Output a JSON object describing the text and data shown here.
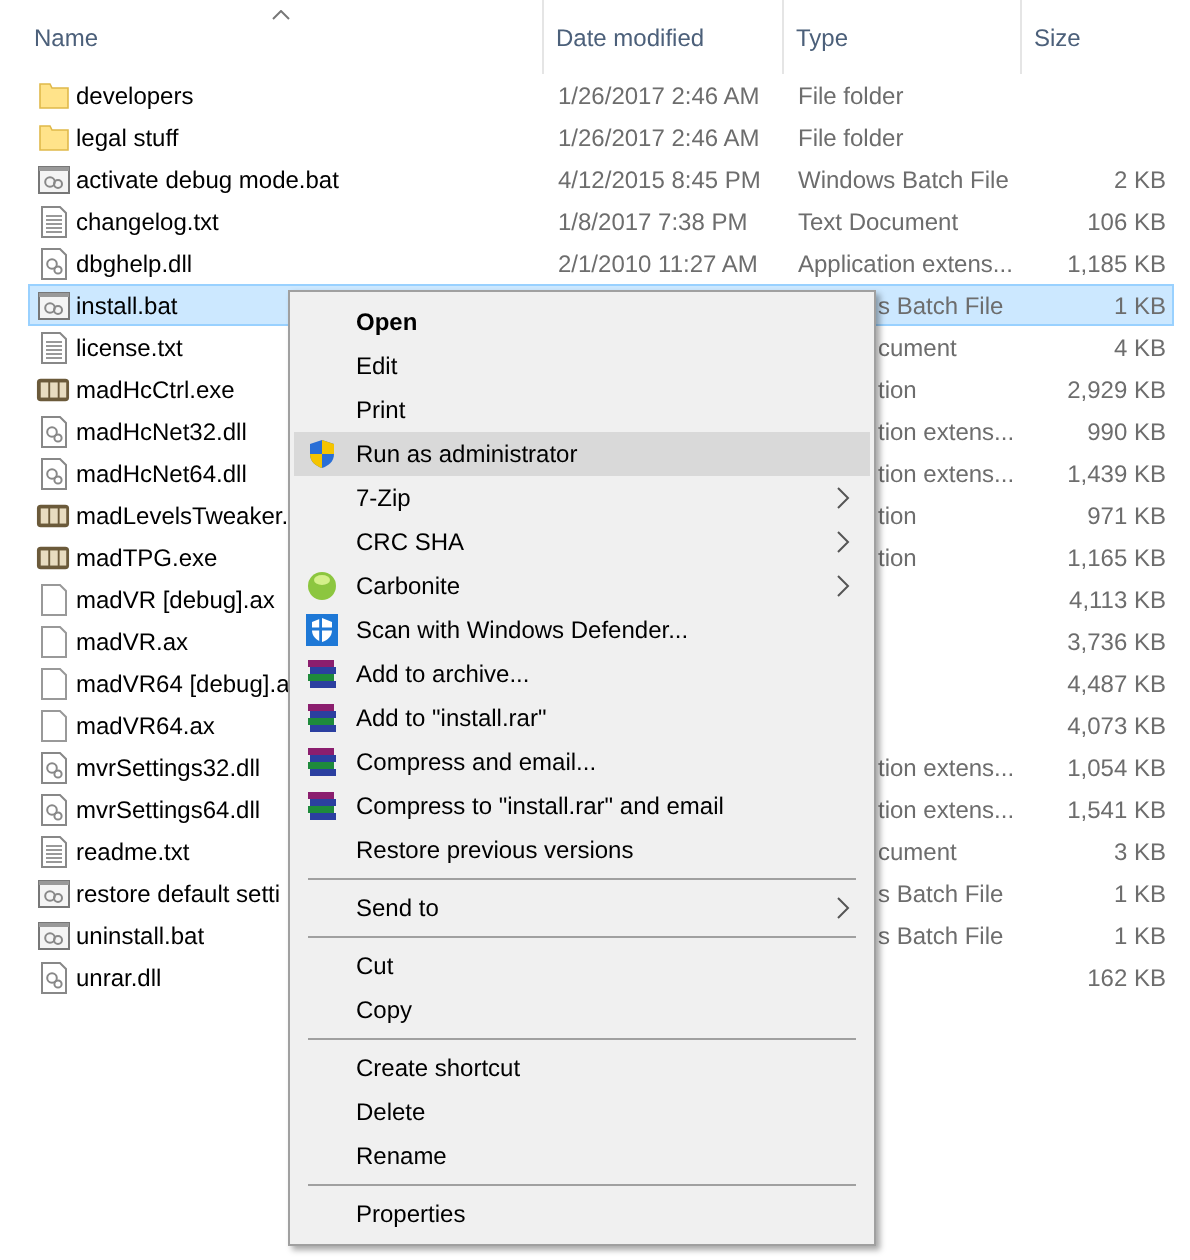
{
  "columns": [
    {
      "label": "Name",
      "sorted": true
    },
    {
      "label": "Date modified",
      "sorted": false
    },
    {
      "label": "Type",
      "sorted": false
    },
    {
      "label": "Size",
      "sorted": false
    }
  ],
  "files": [
    {
      "kind": "folder",
      "name": "developers",
      "date": "1/26/2017 2:46 AM",
      "type": "File folder",
      "selected": false
    },
    {
      "kind": "folder",
      "name": "legal stuff",
      "date": "1/26/2017 2:46 AM",
      "type": "File folder",
      "selected": false
    },
    {
      "kind": "batch",
      "name": "activate debug mode.bat",
      "date": "4/12/2015 8:45 PM",
      "type": "Windows Batch File",
      "size": "2 KB",
      "selected": false
    },
    {
      "kind": "text",
      "name": "changelog.txt",
      "date": "1/8/2017 7:38 PM",
      "type": "Text Document",
      "size": "106 KB",
      "selected": false
    },
    {
      "kind": "dll",
      "name": "dbghelp.dll",
      "date": "2/1/2010 11:27 AM",
      "type": "Application extens...",
      "size": "1,185 KB",
      "selected": false
    },
    {
      "kind": "batch",
      "name": "install.bat",
      "type": "s Batch File",
      "size": "1 KB",
      "selected": true
    },
    {
      "kind": "text",
      "name": "license.txt",
      "type": "cument",
      "size": "4 KB",
      "selected": false
    },
    {
      "kind": "exe",
      "name": "madHcCtrl.exe",
      "type": "tion",
      "size": "2,929 KB",
      "selected": false
    },
    {
      "kind": "dll",
      "name": "madHcNet32.dll",
      "type": "tion extens...",
      "size": "990 KB",
      "selected": false
    },
    {
      "kind": "dll",
      "name": "madHcNet64.dll",
      "type": "tion extens...",
      "size": "1,439 KB",
      "selected": false
    },
    {
      "kind": "exe",
      "name": "madLevelsTweaker.",
      "type": "tion",
      "size": "971 KB",
      "selected": false
    },
    {
      "kind": "exe",
      "name": "madTPG.exe",
      "type": "tion",
      "size": "1,165 KB",
      "selected": false
    },
    {
      "kind": "blank",
      "name": "madVR [debug].ax",
      "size": "4,113 KB",
      "selected": false
    },
    {
      "kind": "blank",
      "name": "madVR.ax",
      "size": "3,736 KB",
      "selected": false
    },
    {
      "kind": "blank",
      "name": "madVR64 [debug].a",
      "size": "4,487 KB",
      "selected": false
    },
    {
      "kind": "blank",
      "name": "madVR64.ax",
      "size": "4,073 KB",
      "selected": false
    },
    {
      "kind": "dll",
      "name": "mvrSettings32.dll",
      "type": "tion extens...",
      "size": "1,054 KB",
      "selected": false
    },
    {
      "kind": "dll",
      "name": "mvrSettings64.dll",
      "type": "tion extens...",
      "size": "1,541 KB",
      "selected": false
    },
    {
      "kind": "text",
      "name": "readme.txt",
      "type": "cument",
      "size": "3 KB",
      "selected": false
    },
    {
      "kind": "batch",
      "name": "restore default setti",
      "type": "s Batch File",
      "size": "1 KB",
      "selected": false
    },
    {
      "kind": "batch",
      "name": "uninstall.bat",
      "type": "s Batch File",
      "size": "1 KB",
      "selected": false
    },
    {
      "kind": "dll",
      "name": "unrar.dll",
      "size": "162 KB",
      "selected": false
    }
  ],
  "context_menu": {
    "groups": [
      [
        {
          "label": "Open",
          "default": true,
          "selected": false,
          "submenu": false
        },
        {
          "label": "Edit",
          "default": false,
          "selected": false,
          "submenu": false
        },
        {
          "label": "Print",
          "default": false,
          "selected": false,
          "submenu": false
        },
        {
          "label": "Run as administrator",
          "kind": "shield",
          "default": false,
          "selected": true,
          "submenu": false
        },
        {
          "label": "7-Zip",
          "default": false,
          "selected": false,
          "submenu": true
        },
        {
          "label": "CRC SHA",
          "default": false,
          "selected": false,
          "submenu": true
        },
        {
          "label": "Carbonite",
          "kind": "ball",
          "default": false,
          "selected": false,
          "submenu": true
        },
        {
          "label": "Scan with Windows Defender...",
          "kind": "defender",
          "default": false,
          "selected": false,
          "submenu": false
        },
        {
          "label": "Add to archive...",
          "kind": "books",
          "default": false,
          "selected": false,
          "submenu": false
        },
        {
          "label": "Add to \"install.rar\"",
          "kind": "books",
          "default": false,
          "selected": false,
          "submenu": false
        },
        {
          "label": "Compress and email...",
          "kind": "books",
          "default": false,
          "selected": false,
          "submenu": false
        },
        {
          "label": "Compress to \"install.rar\" and email",
          "kind": "books",
          "default": false,
          "selected": false,
          "submenu": false
        },
        {
          "label": "Restore previous versions",
          "default": false,
          "selected": false,
          "submenu": false
        }
      ],
      [
        {
          "label": "Send to",
          "default": false,
          "selected": false,
          "submenu": true
        }
      ],
      [
        {
          "label": "Cut",
          "default": false,
          "selected": false,
          "submenu": false
        },
        {
          "label": "Copy",
          "default": false,
          "selected": false,
          "submenu": false
        }
      ],
      [
        {
          "label": "Create shortcut",
          "default": false,
          "selected": false,
          "submenu": false
        },
        {
          "label": "Delete",
          "default": false,
          "selected": false,
          "submenu": false
        },
        {
          "label": "Rename",
          "default": false,
          "selected": false,
          "submenu": false
        }
      ],
      [
        {
          "label": "Properties",
          "default": false,
          "selected": false,
          "submenu": false
        }
      ]
    ]
  }
}
